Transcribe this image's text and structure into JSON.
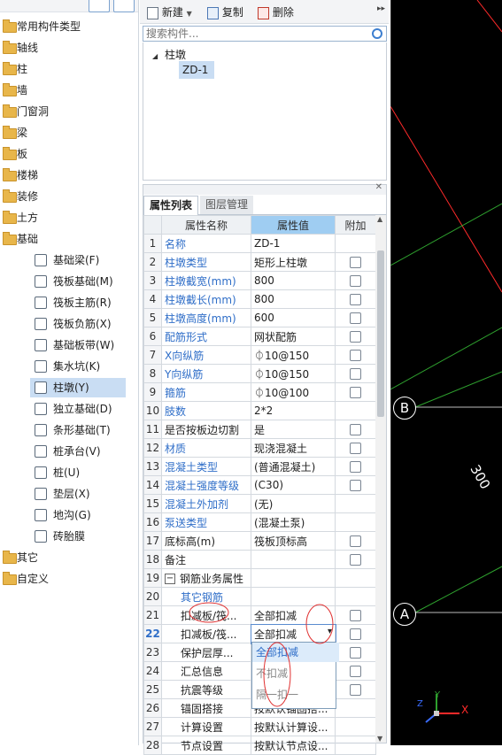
{
  "tree": {
    "items": [
      {
        "label": "常用构件类型",
        "type": "folder"
      },
      {
        "label": "轴线",
        "type": "folder"
      },
      {
        "label": "柱",
        "type": "folder"
      },
      {
        "label": "墙",
        "type": "folder"
      },
      {
        "label": "门窗洞",
        "type": "folder"
      },
      {
        "label": "梁",
        "type": "folder"
      },
      {
        "label": "板",
        "type": "folder"
      },
      {
        "label": "楼梯",
        "type": "folder"
      },
      {
        "label": "装修",
        "type": "folder"
      },
      {
        "label": "土方",
        "type": "folder"
      },
      {
        "label": "基础",
        "type": "folder"
      }
    ],
    "sub_items": [
      {
        "label": "基础梁(F)",
        "icon": "foundation-beam-icon"
      },
      {
        "label": "筏板基础(M)",
        "icon": "raft-foundation-icon"
      },
      {
        "label": "筏板主筋(R)",
        "icon": "raft-main-rebar-icon"
      },
      {
        "label": "筏板负筋(X)",
        "icon": "raft-negative-rebar-icon"
      },
      {
        "label": "基础板带(W)",
        "icon": "foundation-strip-icon"
      },
      {
        "label": "集水坑(K)",
        "icon": "sump-pit-icon"
      },
      {
        "label": "柱墩(Y)",
        "icon": "column-pier-icon",
        "selected": true
      },
      {
        "label": "独立基础(D)",
        "icon": "isolated-foundation-icon"
      },
      {
        "label": "条形基础(T)",
        "icon": "strip-foundation-icon"
      },
      {
        "label": "桩承台(V)",
        "icon": "pile-cap-icon"
      },
      {
        "label": "桩(U)",
        "icon": "pile-icon"
      },
      {
        "label": "垫层(X)",
        "icon": "cushion-icon"
      },
      {
        "label": "地沟(G)",
        "icon": "trench-icon"
      },
      {
        "label": "砖胎膜",
        "icon": "brick-mold-icon"
      }
    ],
    "tail_items": [
      {
        "label": "其它",
        "type": "folder"
      },
      {
        "label": "自定义",
        "type": "folder"
      }
    ]
  },
  "toolbar": {
    "new_label": "新建",
    "copy_label": "复制",
    "delete_label": "删除"
  },
  "search": {
    "placeholder": "搜索构件..."
  },
  "component_tree": {
    "group": "柱墩",
    "item": "ZD-1"
  },
  "props": {
    "tabs": [
      "属性列表",
      "图层管理"
    ],
    "headers": {
      "name": "属性名称",
      "value": "属性值",
      "extra": "附加"
    },
    "rows": [
      {
        "n": "1",
        "name": "名称",
        "value": "ZD-1",
        "blue": true,
        "cb": false
      },
      {
        "n": "2",
        "name": "柱墩类型",
        "value": "矩形上柱墩",
        "blue": true,
        "cb": true
      },
      {
        "n": "3",
        "name": "柱墩截宽(mm)",
        "value": "800",
        "blue": true,
        "cb": true
      },
      {
        "n": "4",
        "name": "柱墩截长(mm)",
        "value": "800",
        "blue": true,
        "cb": true
      },
      {
        "n": "5",
        "name": "柱墩高度(mm)",
        "value": "600",
        "blue": true,
        "cb": true
      },
      {
        "n": "6",
        "name": "配筋形式",
        "value": "网状配筋",
        "blue": true,
        "cb": true
      },
      {
        "n": "7",
        "name": "X向纵筋",
        "value": "⏀10@150",
        "blue": true,
        "cb": true
      },
      {
        "n": "8",
        "name": "Y向纵筋",
        "value": "⏀10@150",
        "blue": true,
        "cb": true
      },
      {
        "n": "9",
        "name": "箍筋",
        "value": "⏀10@100",
        "blue": true,
        "cb": true
      },
      {
        "n": "10",
        "name": "肢数",
        "value": "2*2",
        "blue": true,
        "cb": false
      },
      {
        "n": "11",
        "name": "是否按板边切割",
        "value": "是",
        "blue": false,
        "cb": true
      },
      {
        "n": "12",
        "name": "材质",
        "value": "现浇混凝土",
        "blue": true,
        "cb": true
      },
      {
        "n": "13",
        "name": "混凝土类型",
        "value": "(普通混凝土)",
        "blue": true,
        "cb": true
      },
      {
        "n": "14",
        "name": "混凝土强度等级",
        "value": "(C30)",
        "blue": true,
        "cb": true
      },
      {
        "n": "15",
        "name": "混凝土外加剂",
        "value": "(无)",
        "blue": true,
        "cb": false
      },
      {
        "n": "16",
        "name": "泵送类型",
        "value": "(混凝土泵)",
        "blue": true,
        "cb": false
      },
      {
        "n": "17",
        "name": "底标高(m)",
        "value": "筏板顶标高",
        "blue": false,
        "cb": true
      },
      {
        "n": "18",
        "name": "备注",
        "value": "",
        "blue": false,
        "cb": true
      },
      {
        "n": "19",
        "name": "钢筋业务属性",
        "value": "",
        "blue": false,
        "cb": false,
        "group": true
      },
      {
        "n": "20",
        "name": "其它钢筋",
        "value": "",
        "blue": true,
        "cb": false,
        "indent": true
      },
      {
        "n": "21",
        "name": "扣减板/筏...",
        "value": "全部扣减",
        "blue": false,
        "cb": true,
        "indent": true
      },
      {
        "n": "22",
        "name": "扣减板/筏...",
        "value": "全部扣减",
        "blue": false,
        "cb": true,
        "indent": true,
        "active": true
      },
      {
        "n": "23",
        "name": "保护层厚...",
        "value": "",
        "blue": false,
        "cb": true,
        "indent": true
      },
      {
        "n": "24",
        "name": "汇总信息",
        "value": "",
        "blue": false,
        "cb": true,
        "indent": true
      },
      {
        "n": "25",
        "name": "抗震等级",
        "value": "",
        "blue": false,
        "cb": true,
        "indent": true
      },
      {
        "n": "26",
        "name": "锚固搭接",
        "value": "按默认锚固搭...",
        "blue": false,
        "cb": false,
        "indent": true
      },
      {
        "n": "27",
        "name": "计算设置",
        "value": "按默认计算设...",
        "blue": false,
        "cb": false,
        "indent": true
      },
      {
        "n": "28",
        "name": "节点设置",
        "value": "按默认节点设...",
        "blue": false,
        "cb": false,
        "indent": true
      }
    ],
    "dropdown_options": [
      "全部扣减",
      "不扣减",
      "隔一扣一"
    ]
  },
  "cad": {
    "axis_b": "B",
    "axis_a": "A",
    "dimension": "300",
    "axis_x": "X",
    "axis_y": "Y",
    "axis_z": "Z",
    "colors": {
      "red": "#ff2a2a",
      "green": "#2ea02e",
      "white": "#ffffff"
    }
  }
}
